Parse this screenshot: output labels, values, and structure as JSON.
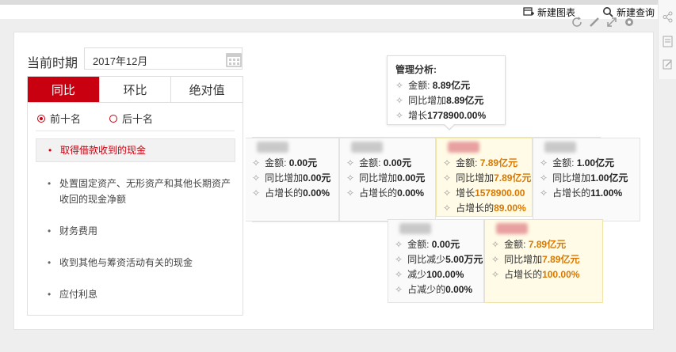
{
  "header": {
    "new_chart_label": "新建图表",
    "new_query_label": "新建查询"
  },
  "filter": {
    "period_label": "当前时期",
    "date_value": "2017年12月",
    "tabs": [
      "同比",
      "环比",
      "绝对值"
    ],
    "radios": [
      "前十名",
      "后十名"
    ]
  },
  "list": [
    "取得借款收到的现金",
    "处置固定资产、无形资产和其他长期资产收回的现金净额",
    "财务费用",
    "收到其他与筹资活动有关的现金",
    "应付利息"
  ],
  "tooltip": {
    "title": "管理分析:",
    "rows": [
      {
        "label": "金额:",
        "value": "8.89亿元"
      },
      {
        "label": "同比增加",
        "value": "8.89亿元"
      },
      {
        "label": "增长",
        "value": "1778900.00%"
      }
    ]
  },
  "nodes": [
    {
      "rows": [
        {
          "label": "金额:",
          "value": "0.00元"
        },
        {
          "label": "同比增加",
          "value": "0.00元"
        },
        {
          "label": "占增长的",
          "value": "0.00%"
        }
      ]
    },
    {
      "rows": [
        {
          "label": "金额:",
          "value": "0.00元"
        },
        {
          "label": "同比增加",
          "value": "0.00元"
        },
        {
          "label": "占增长的",
          "value": "0.00%"
        }
      ]
    },
    {
      "rows": [
        {
          "label": "金额:",
          "value": "7.89亿元"
        },
        {
          "label": "同比增加",
          "value": "7.89亿元"
        },
        {
          "label": "增长",
          "value": "1578900.00"
        },
        {
          "label": "占增长的",
          "value": "89.00%"
        }
      ]
    },
    {
      "rows": [
        {
          "label": "金额:",
          "value": "1.00亿元"
        },
        {
          "label": "同比增加",
          "value": "1.00亿元"
        },
        {
          "label": "占增长的",
          "value": "11.00%"
        }
      ]
    },
    {
      "rows": [
        {
          "label": "金额:",
          "value": "0.00元"
        },
        {
          "label": "同比减少",
          "value": "5.00万元"
        },
        {
          "label": "减少",
          "value": "100.00%"
        },
        {
          "label": "占减少的",
          "value": "0.00%"
        }
      ]
    },
    {
      "rows": [
        {
          "label": "金额:",
          "value": "7.89亿元"
        },
        {
          "label": "同比增加",
          "value": "7.89亿元"
        },
        {
          "label": "占增长的",
          "value": "100.00%"
        }
      ]
    }
  ],
  "icons": {
    "refresh": "refresh-icon",
    "edit": "edit-icon",
    "expand": "expand-icon",
    "settings": "gear-icon",
    "delete": "trash-icon",
    "share": "share-icon"
  },
  "colors": {
    "accent": "#c8000f",
    "highlight_value": "#d97800",
    "highlight_bg": "#fffbe6"
  }
}
